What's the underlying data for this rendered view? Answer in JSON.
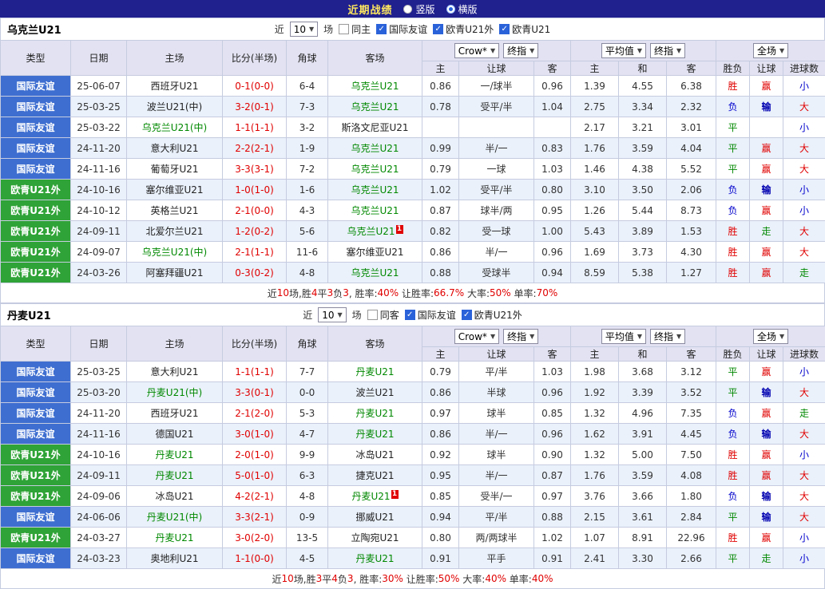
{
  "topbar": {
    "title": "近期战绩",
    "radios": [
      {
        "label": "竖版",
        "checked": false
      },
      {
        "label": "横版",
        "checked": true
      }
    ]
  },
  "table_header": {
    "type": "类型",
    "date": "日期",
    "home": "主场",
    "score": "比分(半场)",
    "corner": "角球",
    "away": "客场",
    "odds_source_select": "Crow*",
    "odds_time_select": "终指",
    "odds_home": "主",
    "odds_line": "让球",
    "odds_away": "客",
    "avg_source_select": "平均值",
    "avg_time_select": "终指",
    "avg_home": "主",
    "avg_draw": "和",
    "avg_away": "客",
    "scope_select": "全场",
    "result_wdl": "胜负",
    "result_handicap": "让球",
    "result_goals": "进球数"
  },
  "colors": {
    "topbar_bg": "#20208e",
    "title_text": "#ffe95e",
    "type_friendly_badge": "#3e6ed0",
    "type_euro_qual_badge": "#2fa337",
    "focus_team_text": "#008800",
    "win_red": "#e00000",
    "lose_blue": "#0000cc",
    "draw_green": "#008800",
    "header_bg": "#e2e2f2",
    "alt_row_bg": "#eaf1fb"
  },
  "sections": [
    {
      "team": "乌克兰U21",
      "filter": {
        "prefix": "近",
        "count": "10",
        "suffix": "场",
        "checks": [
          {
            "label": "同主",
            "checked": false
          },
          {
            "label": "国际友谊",
            "checked": true
          },
          {
            "label": "欧青U21外",
            "checked": true
          },
          {
            "label": "欧青U21",
            "checked": true
          }
        ]
      },
      "rows": [
        {
          "type": "国际友谊",
          "date": "25-06-07",
          "home": "西班牙U21",
          "score": "0-1(0-0)",
          "corner": "6-4",
          "away": "乌克兰U21",
          "rc": "",
          "oh": "0.86",
          "line": "一/球半",
          "oa": "0.96",
          "ah": "1.39",
          "ad": "4.55",
          "aa": "6.38",
          "wdl": "胜",
          "hcp": "赢",
          "goal": "小"
        },
        {
          "type": "国际友谊",
          "date": "25-03-25",
          "home": "波兰U21(中)",
          "score": "3-2(0-1)",
          "corner": "7-3",
          "away": "乌克兰U21",
          "rc": "",
          "oh": "0.78",
          "line": "受平/半",
          "oa": "1.04",
          "ah": "2.75",
          "ad": "3.34",
          "aa": "2.32",
          "wdl": "负",
          "hcp": "输",
          "goal": "大"
        },
        {
          "type": "国际友谊",
          "date": "25-03-22",
          "home": "乌克兰U21(中)",
          "score": "1-1(1-1)",
          "corner": "3-2",
          "away": "斯洛文尼亚U21",
          "rc": "",
          "oh": "",
          "line": "",
          "oa": "",
          "ah": "2.17",
          "ad": "3.21",
          "aa": "3.01",
          "wdl": "平",
          "hcp": "",
          "goal": "小"
        },
        {
          "type": "国际友谊",
          "date": "24-11-20",
          "home": "意大利U21",
          "score": "2-2(2-1)",
          "corner": "1-9",
          "away": "乌克兰U21",
          "rc": "",
          "oh": "0.99",
          "line": "半/一",
          "oa": "0.83",
          "ah": "1.76",
          "ad": "3.59",
          "aa": "4.04",
          "wdl": "平",
          "hcp": "赢",
          "goal": "大"
        },
        {
          "type": "国际友谊",
          "date": "24-11-16",
          "home": "葡萄牙U21",
          "score": "3-3(3-1)",
          "corner": "7-2",
          "away": "乌克兰U21",
          "rc": "",
          "oh": "0.79",
          "line": "一球",
          "oa": "1.03",
          "ah": "1.46",
          "ad": "4.38",
          "aa": "5.52",
          "wdl": "平",
          "hcp": "赢",
          "goal": "大"
        },
        {
          "type": "欧青U21外",
          "date": "24-10-16",
          "home": "塞尔维亚U21",
          "score": "1-0(1-0)",
          "corner": "1-6",
          "away": "乌克兰U21",
          "rc": "",
          "oh": "1.02",
          "line": "受平/半",
          "oa": "0.80",
          "ah": "3.10",
          "ad": "3.50",
          "aa": "2.06",
          "wdl": "负",
          "hcp": "输",
          "goal": "小"
        },
        {
          "type": "欧青U21外",
          "date": "24-10-12",
          "home": "英格兰U21",
          "score": "2-1(0-0)",
          "corner": "4-3",
          "away": "乌克兰U21",
          "rc": "",
          "oh": "0.87",
          "line": "球半/两",
          "oa": "0.95",
          "ah": "1.26",
          "ad": "5.44",
          "aa": "8.73",
          "wdl": "负",
          "hcp": "赢",
          "goal": "小"
        },
        {
          "type": "欧青U21外",
          "date": "24-09-11",
          "home": "北爱尔兰U21",
          "score": "1-2(0-2)",
          "corner": "5-6",
          "away": "乌克兰U21",
          "rc": "1",
          "oh": "0.82",
          "line": "受一球",
          "oa": "1.00",
          "ah": "5.43",
          "ad": "3.89",
          "aa": "1.53",
          "wdl": "胜",
          "hcp": "走",
          "goal": "大"
        },
        {
          "type": "欧青U21外",
          "date": "24-09-07",
          "home": "乌克兰U21(中)",
          "score": "2-1(1-1)",
          "corner": "11-6",
          "away": "塞尔维亚U21",
          "rc": "",
          "oh": "0.86",
          "line": "半/一",
          "oa": "0.96",
          "ah": "1.69",
          "ad": "3.73",
          "aa": "4.30",
          "wdl": "胜",
          "hcp": "赢",
          "goal": "大"
        },
        {
          "type": "欧青U21外",
          "date": "24-03-26",
          "home": "阿塞拜疆U21",
          "score": "0-3(0-2)",
          "corner": "4-8",
          "away": "乌克兰U21",
          "rc": "",
          "oh": "0.88",
          "line": "受球半",
          "oa": "0.94",
          "ah": "8.59",
          "ad": "5.38",
          "aa": "1.27",
          "wdl": "胜",
          "hcp": "赢",
          "goal": "走"
        }
      ],
      "summary": [
        {
          "t": "近",
          "r": 0
        },
        {
          "t": "10",
          "r": 1
        },
        {
          "t": "场,胜",
          "r": 0
        },
        {
          "t": "4",
          "r": 1
        },
        {
          "t": "平",
          "r": 0
        },
        {
          "t": "3",
          "r": 1
        },
        {
          "t": "负",
          "r": 0
        },
        {
          "t": "3",
          "r": 1
        },
        {
          "t": ", 胜率:",
          "r": 0
        },
        {
          "t": "40%",
          "r": 1
        },
        {
          "t": " 让胜率:",
          "r": 0
        },
        {
          "t": "66.7%",
          "r": 1
        },
        {
          "t": " 大率:",
          "r": 0
        },
        {
          "t": "50%",
          "r": 1
        },
        {
          "t": " 单率:",
          "r": 0
        },
        {
          "t": "70%",
          "r": 1
        }
      ]
    },
    {
      "team": "丹麦U21",
      "filter": {
        "prefix": "近",
        "count": "10",
        "suffix": "场",
        "checks": [
          {
            "label": "同客",
            "checked": false
          },
          {
            "label": "国际友谊",
            "checked": true
          },
          {
            "label": "欧青U21外",
            "checked": true
          }
        ]
      },
      "rows": [
        {
          "type": "国际友谊",
          "date": "25-03-25",
          "home": "意大利U21",
          "score": "1-1(1-1)",
          "corner": "7-7",
          "away": "丹麦U21",
          "rc": "",
          "oh": "0.79",
          "line": "平/半",
          "oa": "1.03",
          "ah": "1.98",
          "ad": "3.68",
          "aa": "3.12",
          "wdl": "平",
          "hcp": "赢",
          "goal": "小"
        },
        {
          "type": "国际友谊",
          "date": "25-03-20",
          "home": "丹麦U21(中)",
          "score": "3-3(0-1)",
          "corner": "0-0",
          "away": "波兰U21",
          "rc": "",
          "oh": "0.86",
          "line": "半球",
          "oa": "0.96",
          "ah": "1.92",
          "ad": "3.39",
          "aa": "3.52",
          "wdl": "平",
          "hcp": "输",
          "goal": "大"
        },
        {
          "type": "国际友谊",
          "date": "24-11-20",
          "home": "西班牙U21",
          "score": "2-1(2-0)",
          "corner": "5-3",
          "away": "丹麦U21",
          "rc": "",
          "oh": "0.97",
          "line": "球半",
          "oa": "0.85",
          "ah": "1.32",
          "ad": "4.96",
          "aa": "7.35",
          "wdl": "负",
          "hcp": "赢",
          "goal": "走"
        },
        {
          "type": "国际友谊",
          "date": "24-11-16",
          "home": "德国U21",
          "score": "3-0(1-0)",
          "corner": "4-7",
          "away": "丹麦U21",
          "rc": "",
          "oh": "0.86",
          "line": "半/一",
          "oa": "0.96",
          "ah": "1.62",
          "ad": "3.91",
          "aa": "4.45",
          "wdl": "负",
          "hcp": "输",
          "goal": "大"
        },
        {
          "type": "欧青U21外",
          "date": "24-10-16",
          "home": "丹麦U21",
          "score": "2-0(1-0)",
          "corner": "9-9",
          "away": "冰岛U21",
          "rc": "",
          "oh": "0.92",
          "line": "球半",
          "oa": "0.90",
          "ah": "1.32",
          "ad": "5.00",
          "aa": "7.50",
          "wdl": "胜",
          "hcp": "赢",
          "goal": "小"
        },
        {
          "type": "欧青U21外",
          "date": "24-09-11",
          "home": "丹麦U21",
          "score": "5-0(1-0)",
          "corner": "6-3",
          "away": "捷克U21",
          "rc": "",
          "oh": "0.95",
          "line": "半/一",
          "oa": "0.87",
          "ah": "1.76",
          "ad": "3.59",
          "aa": "4.08",
          "wdl": "胜",
          "hcp": "赢",
          "goal": "大"
        },
        {
          "type": "欧青U21外",
          "date": "24-09-06",
          "home": "冰岛U21",
          "score": "4-2(2-1)",
          "corner": "4-8",
          "away": "丹麦U21",
          "rc": "1",
          "oh": "0.85",
          "line": "受半/一",
          "oa": "0.97",
          "ah": "3.76",
          "ad": "3.66",
          "aa": "1.80",
          "wdl": "负",
          "hcp": "输",
          "goal": "大"
        },
        {
          "type": "国际友谊",
          "date": "24-06-06",
          "home": "丹麦U21(中)",
          "score": "3-3(2-1)",
          "corner": "0-9",
          "away": "挪威U21",
          "rc": "",
          "oh": "0.94",
          "line": "平/半",
          "oa": "0.88",
          "ah": "2.15",
          "ad": "3.61",
          "aa": "2.84",
          "wdl": "平",
          "hcp": "输",
          "goal": "大"
        },
        {
          "type": "欧青U21外",
          "date": "24-03-27",
          "home": "丹麦U21",
          "score": "3-0(2-0)",
          "corner": "13-5",
          "away": "立陶宛U21",
          "rc": "",
          "oh": "0.80",
          "line": "两/两球半",
          "oa": "1.02",
          "ah": "1.07",
          "ad": "8.91",
          "aa": "22.96",
          "wdl": "胜",
          "hcp": "赢",
          "goal": "小"
        },
        {
          "type": "国际友谊",
          "date": "24-03-23",
          "home": "奥地利U21",
          "score": "1-1(0-0)",
          "corner": "4-5",
          "away": "丹麦U21",
          "rc": "",
          "oh": "0.91",
          "line": "平手",
          "oa": "0.91",
          "ah": "2.41",
          "ad": "3.30",
          "aa": "2.66",
          "wdl": "平",
          "hcp": "走",
          "goal": "小"
        }
      ],
      "summary": [
        {
          "t": "近",
          "r": 0
        },
        {
          "t": "10",
          "r": 1
        },
        {
          "t": "场,胜",
          "r": 0
        },
        {
          "t": "3",
          "r": 1
        },
        {
          "t": "平",
          "r": 0
        },
        {
          "t": "4",
          "r": 1
        },
        {
          "t": "负",
          "r": 0
        },
        {
          "t": "3",
          "r": 1
        },
        {
          "t": ", 胜率:",
          "r": 0
        },
        {
          "t": "30%",
          "r": 1
        },
        {
          "t": " 让胜率:",
          "r": 0
        },
        {
          "t": "50%",
          "r": 1
        },
        {
          "t": " 大率:",
          "r": 0
        },
        {
          "t": "40%",
          "r": 1
        },
        {
          "t": " 单率:",
          "r": 0
        },
        {
          "t": "40%",
          "r": 1
        }
      ]
    }
  ]
}
